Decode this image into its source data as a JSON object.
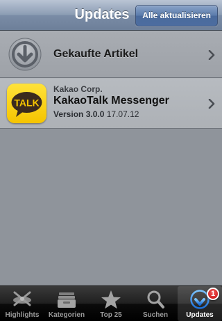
{
  "navbar": {
    "title": "Updates",
    "update_all_label": "Alle aktualisieren"
  },
  "purchased": {
    "label": "Gekaufte Artikel",
    "icon": "purchased-download-icon"
  },
  "app": {
    "developer": "Kakao Corp.",
    "name": "KakaoTalk Messenger",
    "version": "Version 3.0.0",
    "date": "17.07.12",
    "icon_text": "TALK",
    "icon": "kakaotalk-app-icon"
  },
  "tabbar": {
    "tabs": [
      {
        "label": "Highlights",
        "icon": "highlights-icon"
      },
      {
        "label": "Kategorien",
        "icon": "categories-icon"
      },
      {
        "label": "Top 25",
        "icon": "star-icon"
      },
      {
        "label": "Suchen",
        "icon": "search-icon"
      },
      {
        "label": "Updates",
        "icon": "updates-icon",
        "active": true,
        "badge": "1"
      }
    ]
  },
  "colors": {
    "navbar": "#7a8ca6",
    "content_bg": "#8f949b",
    "badge": "#c40d0d",
    "app_icon": "#f5c400"
  }
}
